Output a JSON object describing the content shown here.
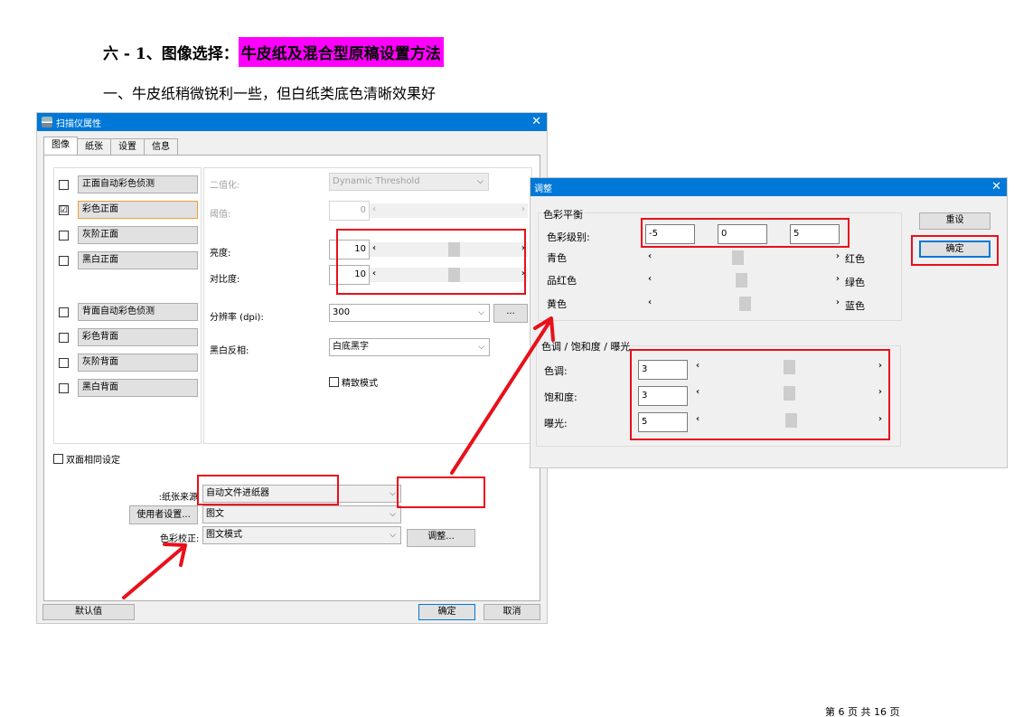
{
  "heading": {
    "prefix": "六 - 1、图像选择：",
    "highlight": "牛皮纸及混合型原稿设置方法"
  },
  "subheading": "一、牛皮纸稍微锐利一些，但白纸类底色清晰效果好",
  "footer": "第 6 页 共 16 页",
  "colors": {
    "highlight": "#ff00ff",
    "annotation_red": "#e8101a",
    "title_blue": "#0078d7"
  },
  "scanner_dialog": {
    "title": "扫描仪属性",
    "tabs": [
      "图像",
      "纸张",
      "设置",
      "信息"
    ],
    "image_types": [
      {
        "label": "正面自动彩色侦测",
        "checked": false
      },
      {
        "label": "彩色正面",
        "checked": true
      },
      {
        "label": "灰阶正面",
        "checked": false
      },
      {
        "label": "黑白正面",
        "checked": false
      },
      {
        "label": "背面自动彩色侦测",
        "checked": false
      },
      {
        "label": "彩色背面",
        "checked": false
      },
      {
        "label": "灰阶背面",
        "checked": false
      },
      {
        "label": "黑白背面",
        "checked": false
      }
    ],
    "check_mark": "☑",
    "binarization_label": "二值化:",
    "binarization_value": "Dynamic Threshold",
    "threshold_label": "阈值:",
    "threshold_value": "0",
    "brightness_label": "亮度:",
    "brightness_value": "10",
    "contrast_label": "对比度:",
    "contrast_value": "10",
    "resolution_label": "分辨率 (dpi):",
    "resolution_value": "300",
    "resolution_more": "...",
    "invert_label": "黑白反相:",
    "invert_value": "白底黑字",
    "fine_mode_label": "精致模式",
    "duplex_same_label": "双面相同设定",
    "paper_source_label": "纸张来源:",
    "paper_source_value": "自动文件进纸器",
    "user_settings_button": "使用者设置...",
    "user_settings_value": "图文",
    "color_correction_label": "色彩校正:",
    "color_correction_value": "图文模式",
    "adjust_button": "调整...",
    "defaults_button": "默认值",
    "ok_button": "确定",
    "cancel_button": "取消"
  },
  "adjust_dialog": {
    "title": "调整",
    "color_balance_group": "色彩平衡",
    "color_level_label": "色彩级别:",
    "color_levels": [
      "-5",
      "0",
      "5"
    ],
    "sliders": [
      {
        "left": "青色",
        "right": "红色"
      },
      {
        "left": "品红色",
        "right": "绿色"
      },
      {
        "left": "黄色",
        "right": "蓝色"
      }
    ],
    "hsv_group": "色调 / 饱和度 / 曝光",
    "hue_label": "色调:",
    "hue_value": "3",
    "saturation_label": "饱和度:",
    "saturation_value": "3",
    "exposure_label": "曝光:",
    "exposure_value": "5",
    "reset_button": "重设",
    "ok_button": "确定"
  },
  "arrow_glyphs": {
    "left": "‹",
    "right": "›",
    "combo": "⌵",
    "close": "✕"
  }
}
